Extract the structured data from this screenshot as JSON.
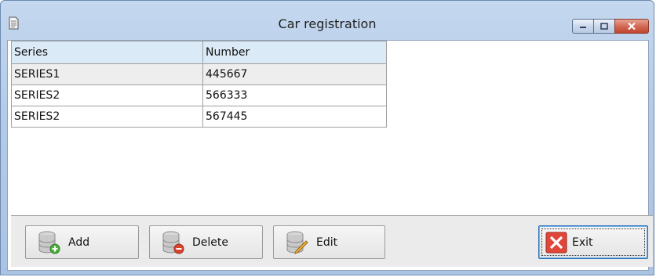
{
  "window": {
    "title": "Car registration"
  },
  "table": {
    "headers": [
      "Series",
      "Number"
    ],
    "rows": [
      [
        "SERIES1",
        "445667"
      ],
      [
        "SERIES2",
        "566333"
      ],
      [
        "SERIES2",
        "567445"
      ]
    ]
  },
  "toolbar": {
    "add_label": "Add",
    "delete_label": "Delete",
    "edit_label": "Edit",
    "exit_label": "Exit"
  },
  "icons": {
    "app": "document-icon",
    "add": "database-add-icon",
    "delete": "database-delete-icon",
    "edit": "database-edit-icon",
    "exit": "close-x-icon"
  },
  "colors": {
    "header_bg": "#dbeaf7",
    "close_button": "#c0442e",
    "exit_icon": "#e0463a"
  }
}
